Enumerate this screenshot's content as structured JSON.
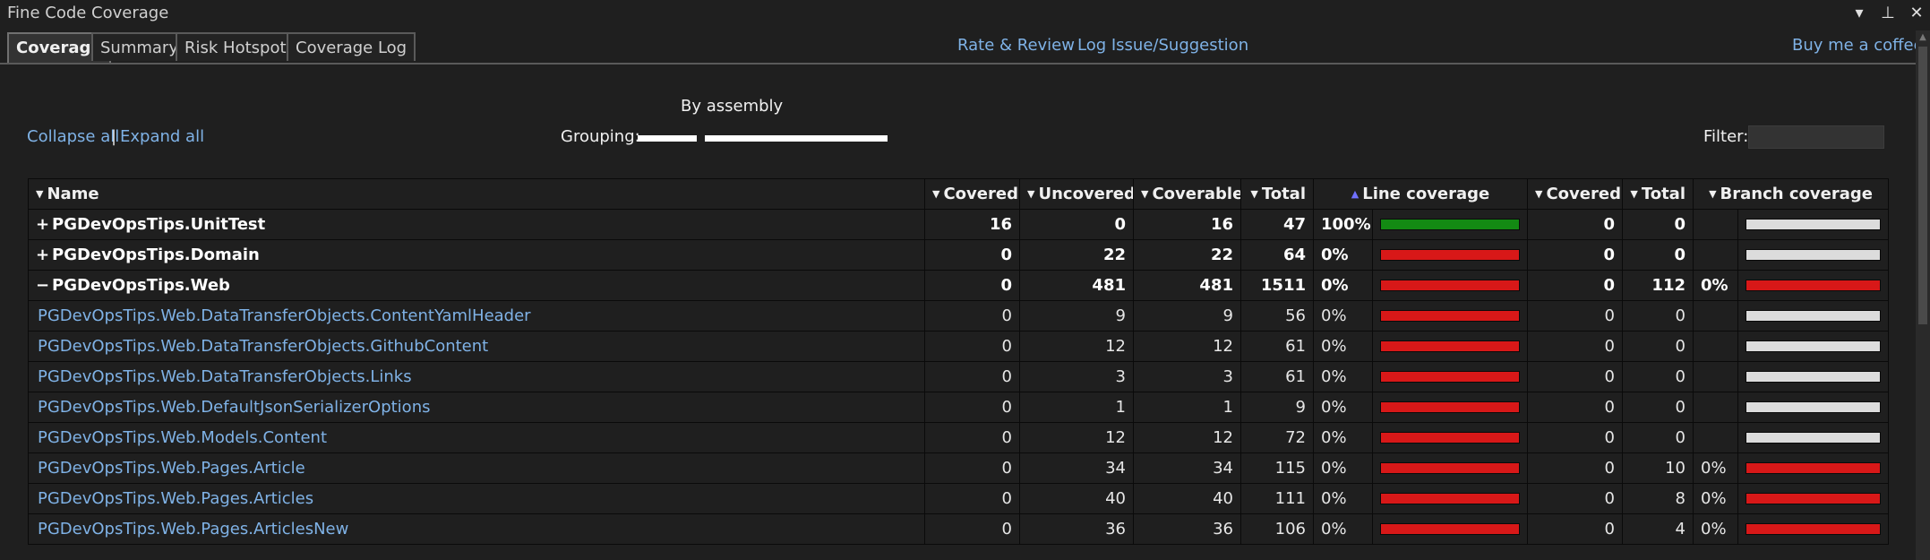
{
  "window": {
    "title": "Fine Code Coverage",
    "controls": [
      "▾",
      "⊥",
      "✕"
    ]
  },
  "tabs": [
    {
      "label": "Coverage",
      "active": true
    },
    {
      "label": "Summary",
      "active": false
    },
    {
      "label": "Risk Hotspots",
      "active": false
    },
    {
      "label": "Coverage Log",
      "active": false
    }
  ],
  "links": {
    "rate_review": "Rate & Review",
    "log_issue": "Log Issue/Suggestion",
    "coffee": "Buy me a coffee"
  },
  "toolbar": {
    "collapse_all": "Collapse all",
    "separator": "|",
    "expand_all": "Expand all",
    "grouping_title": "By assembly",
    "grouping_label": "Grouping:",
    "filter_label": "Filter:",
    "filter_value": ""
  },
  "table": {
    "headers": {
      "name": "Name",
      "covered": "Covered",
      "uncovered": "Uncovered",
      "coverable": "Coverable",
      "total": "Total",
      "line_coverage": "Line coverage",
      "branch_covered": "Covered",
      "branch_total": "Total",
      "branch_coverage": "Branch coverage"
    },
    "rows": [
      {
        "type": "assembly",
        "toggle": "+",
        "name": "PGDevOpsTips.UnitTest",
        "covered": "16",
        "uncovered": "0",
        "coverable": "16",
        "total": "47",
        "line_pct": "100%",
        "line_fill": 1.0,
        "b_covered": "0",
        "b_total": "0",
        "branch_pct": "",
        "branch_fill": null
      },
      {
        "type": "assembly",
        "toggle": "+",
        "name": "PGDevOpsTips.Domain",
        "covered": "0",
        "uncovered": "22",
        "coverable": "22",
        "total": "64",
        "line_pct": "0%",
        "line_fill": 0.0,
        "b_covered": "0",
        "b_total": "0",
        "branch_pct": "",
        "branch_fill": null
      },
      {
        "type": "assembly",
        "toggle": "−",
        "name": "PGDevOpsTips.Web",
        "covered": "0",
        "uncovered": "481",
        "coverable": "481",
        "total": "1511",
        "line_pct": "0%",
        "line_fill": 0.0,
        "b_covered": "0",
        "b_total": "112",
        "branch_pct": "0%",
        "branch_fill": 0.0
      },
      {
        "type": "class",
        "name": "PGDevOpsTips.Web.DataTransferObjects.ContentYamlHeader",
        "covered": "0",
        "uncovered": "9",
        "coverable": "9",
        "total": "56",
        "line_pct": "0%",
        "line_fill": 0.0,
        "b_covered": "0",
        "b_total": "0",
        "branch_pct": "",
        "branch_fill": null
      },
      {
        "type": "class",
        "name": "PGDevOpsTips.Web.DataTransferObjects.GithubContent",
        "covered": "0",
        "uncovered": "12",
        "coverable": "12",
        "total": "61",
        "line_pct": "0%",
        "line_fill": 0.0,
        "b_covered": "0",
        "b_total": "0",
        "branch_pct": "",
        "branch_fill": null
      },
      {
        "type": "class",
        "name": "PGDevOpsTips.Web.DataTransferObjects.Links",
        "covered": "0",
        "uncovered": "3",
        "coverable": "3",
        "total": "61",
        "line_pct": "0%",
        "line_fill": 0.0,
        "b_covered": "0",
        "b_total": "0",
        "branch_pct": "",
        "branch_fill": null
      },
      {
        "type": "class",
        "name": "PGDevOpsTips.Web.DefaultJsonSerializerOptions",
        "covered": "0",
        "uncovered": "1",
        "coverable": "1",
        "total": "9",
        "line_pct": "0%",
        "line_fill": 0.0,
        "b_covered": "0",
        "b_total": "0",
        "branch_pct": "",
        "branch_fill": null
      },
      {
        "type": "class",
        "name": "PGDevOpsTips.Web.Models.Content",
        "covered": "0",
        "uncovered": "12",
        "coverable": "12",
        "total": "72",
        "line_pct": "0%",
        "line_fill": 0.0,
        "b_covered": "0",
        "b_total": "0",
        "branch_pct": "",
        "branch_fill": null
      },
      {
        "type": "class",
        "name": "PGDevOpsTips.Web.Pages.Article",
        "covered": "0",
        "uncovered": "34",
        "coverable": "34",
        "total": "115",
        "line_pct": "0%",
        "line_fill": 0.0,
        "b_covered": "0",
        "b_total": "10",
        "branch_pct": "0%",
        "branch_fill": 0.0
      },
      {
        "type": "class",
        "name": "PGDevOpsTips.Web.Pages.Articles",
        "covered": "0",
        "uncovered": "40",
        "coverable": "40",
        "total": "111",
        "line_pct": "0%",
        "line_fill": 0.0,
        "b_covered": "0",
        "b_total": "8",
        "branch_pct": "0%",
        "branch_fill": 0.0
      },
      {
        "type": "class",
        "name": "PGDevOpsTips.Web.Pages.ArticlesNew",
        "covered": "0",
        "uncovered": "36",
        "coverable": "36",
        "total": "106",
        "line_pct": "0%",
        "line_fill": 0.0,
        "b_covered": "0",
        "b_total": "4",
        "branch_pct": "0%",
        "branch_fill": 0.0
      }
    ]
  },
  "colors": {
    "covered": "#138a13",
    "uncovered": "#d81818",
    "no_data": "#dcdcdc",
    "link": "#7fb2e6"
  }
}
